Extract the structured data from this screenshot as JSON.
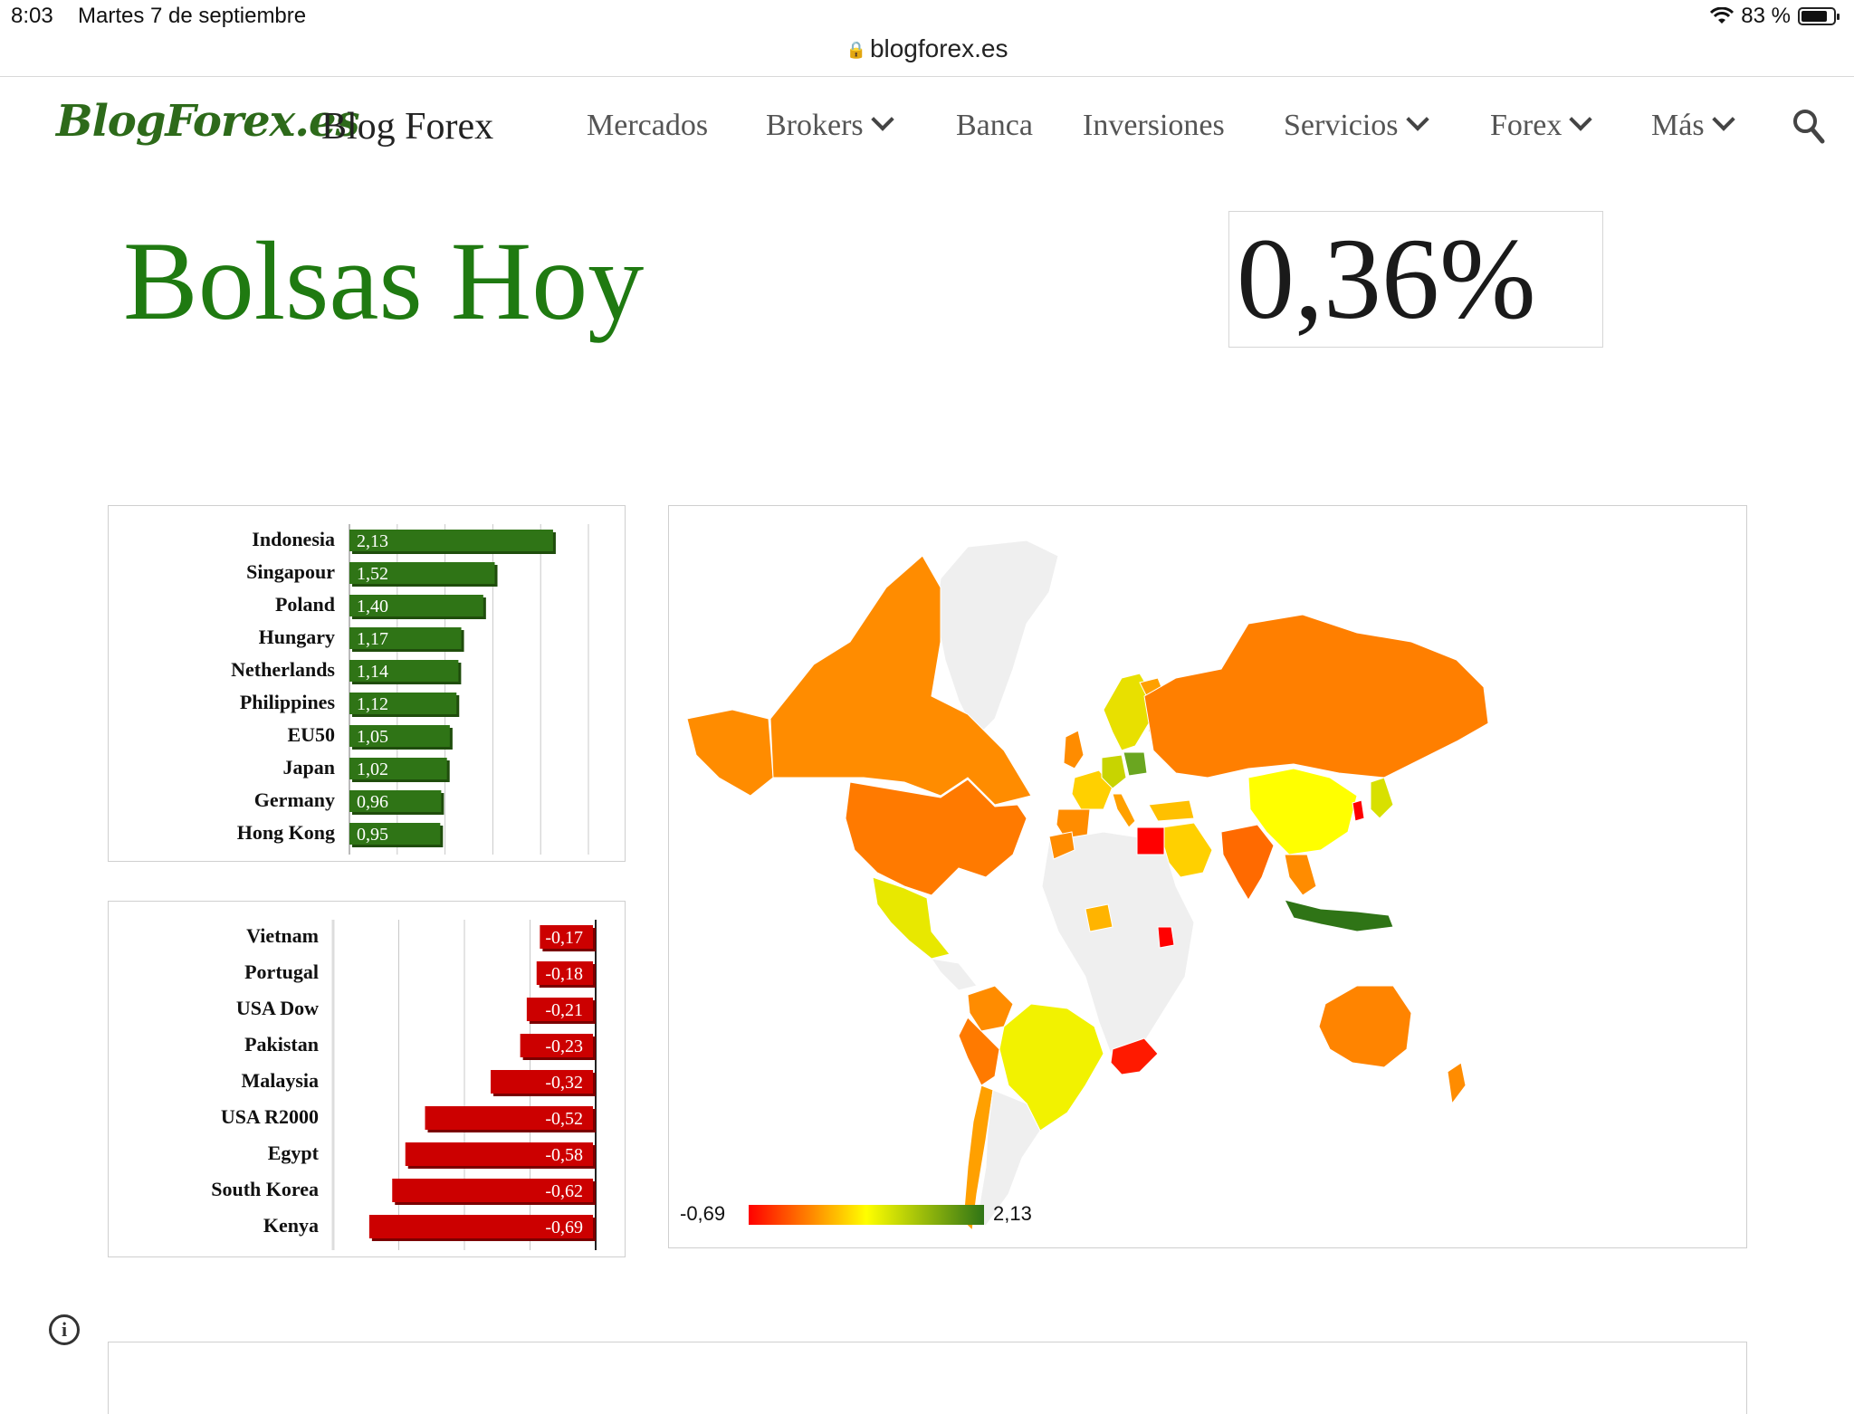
{
  "status_bar": {
    "time": "8:03",
    "date": "Martes 7 de septiembre",
    "battery": "83 %",
    "battery_level": 0.83
  },
  "browser": {
    "url": "blogforex.es"
  },
  "header": {
    "logo": "BlogForex.es",
    "site_title": "Blog Forex",
    "nav": [
      {
        "label": "Mercados",
        "dropdown": false
      },
      {
        "label": "Brokers",
        "dropdown": true
      },
      {
        "label": "Banca",
        "dropdown": false
      },
      {
        "label": "Inversiones",
        "dropdown": false
      },
      {
        "label": "Servicios",
        "dropdown": true
      },
      {
        "label": "Forex",
        "dropdown": true
      },
      {
        "label": "Más",
        "dropdown": true
      }
    ],
    "search_icon": "search-icon"
  },
  "main": {
    "title": "Bolsas Hoy",
    "change": "0,36%"
  },
  "colors": {
    "green": "#2f7416",
    "red": "#cc0000",
    "brand": "#1f7a11",
    "scale_min": "#ff0000",
    "scale_mid": "#ffff00",
    "scale_max": "#2f7416"
  },
  "chart_data": [
    {
      "type": "bar",
      "orientation": "horizontal",
      "categories": [
        "Indonesia",
        "Singapour",
        "Poland",
        "Hungary",
        "Netherlands",
        "Philippines",
        "EU50",
        "Japan",
        "Germany",
        "Hong Kong"
      ],
      "values": [
        2.13,
        1.52,
        1.4,
        1.17,
        1.14,
        1.12,
        1.05,
        1.02,
        0.96,
        0.95
      ],
      "labels": [
        "2,13",
        "1,52",
        "1,40",
        "1,17",
        "1,14",
        "1,12",
        "1,05",
        "1,02",
        "0,96",
        "0,95"
      ],
      "xlim": [
        0,
        2.5
      ],
      "grid": true
    },
    {
      "type": "bar",
      "orientation": "horizontal",
      "categories": [
        "Vietnam",
        "Portugal",
        "USA Dow",
        "Pakistan",
        "Malaysia",
        "USA R2000",
        "Egypt",
        "South Korea",
        "Kenya"
      ],
      "values": [
        -0.17,
        -0.18,
        -0.21,
        -0.23,
        -0.32,
        -0.52,
        -0.58,
        -0.62,
        -0.69
      ],
      "labels": [
        "-0,17",
        "-0,18",
        "-0,21",
        "-0,23",
        "-0,32",
        "-0,52",
        "-0,58",
        "-0,62",
        "-0,69"
      ],
      "xlim": [
        -0.8,
        0
      ],
      "grid": true
    },
    {
      "type": "heatmap",
      "subtype": "choropleth-world-map",
      "scale_min": -0.69,
      "scale_max": 2.13,
      "scale_min_label": "-0,69",
      "scale_max_label": "2,13",
      "regions": [
        {
          "name": "Canada",
          "color": "#ff8c00"
        },
        {
          "name": "United States",
          "color": "#ff7a00"
        },
        {
          "name": "Mexico",
          "color": "#e8e800"
        },
        {
          "name": "Brazil",
          "color": "#f2f200"
        },
        {
          "name": "Russia",
          "color": "#ff7f00"
        },
        {
          "name": "China",
          "color": "#ffff00"
        },
        {
          "name": "India",
          "color": "#ff6a00"
        },
        {
          "name": "Australia",
          "color": "#ff8400"
        },
        {
          "name": "Indonesia",
          "color": "#2f7416"
        },
        {
          "name": "Egypt",
          "color": "#ff0000"
        },
        {
          "name": "South Africa",
          "color": "#ff1a00"
        },
        {
          "name": "Saudi Arabia",
          "color": "#ffd000"
        },
        {
          "name": "Kenya",
          "color": "#ff0000"
        },
        {
          "name": "Poland",
          "color": "#6aa620"
        },
        {
          "name": "South Korea",
          "color": "#ff0000"
        }
      ]
    }
  ]
}
